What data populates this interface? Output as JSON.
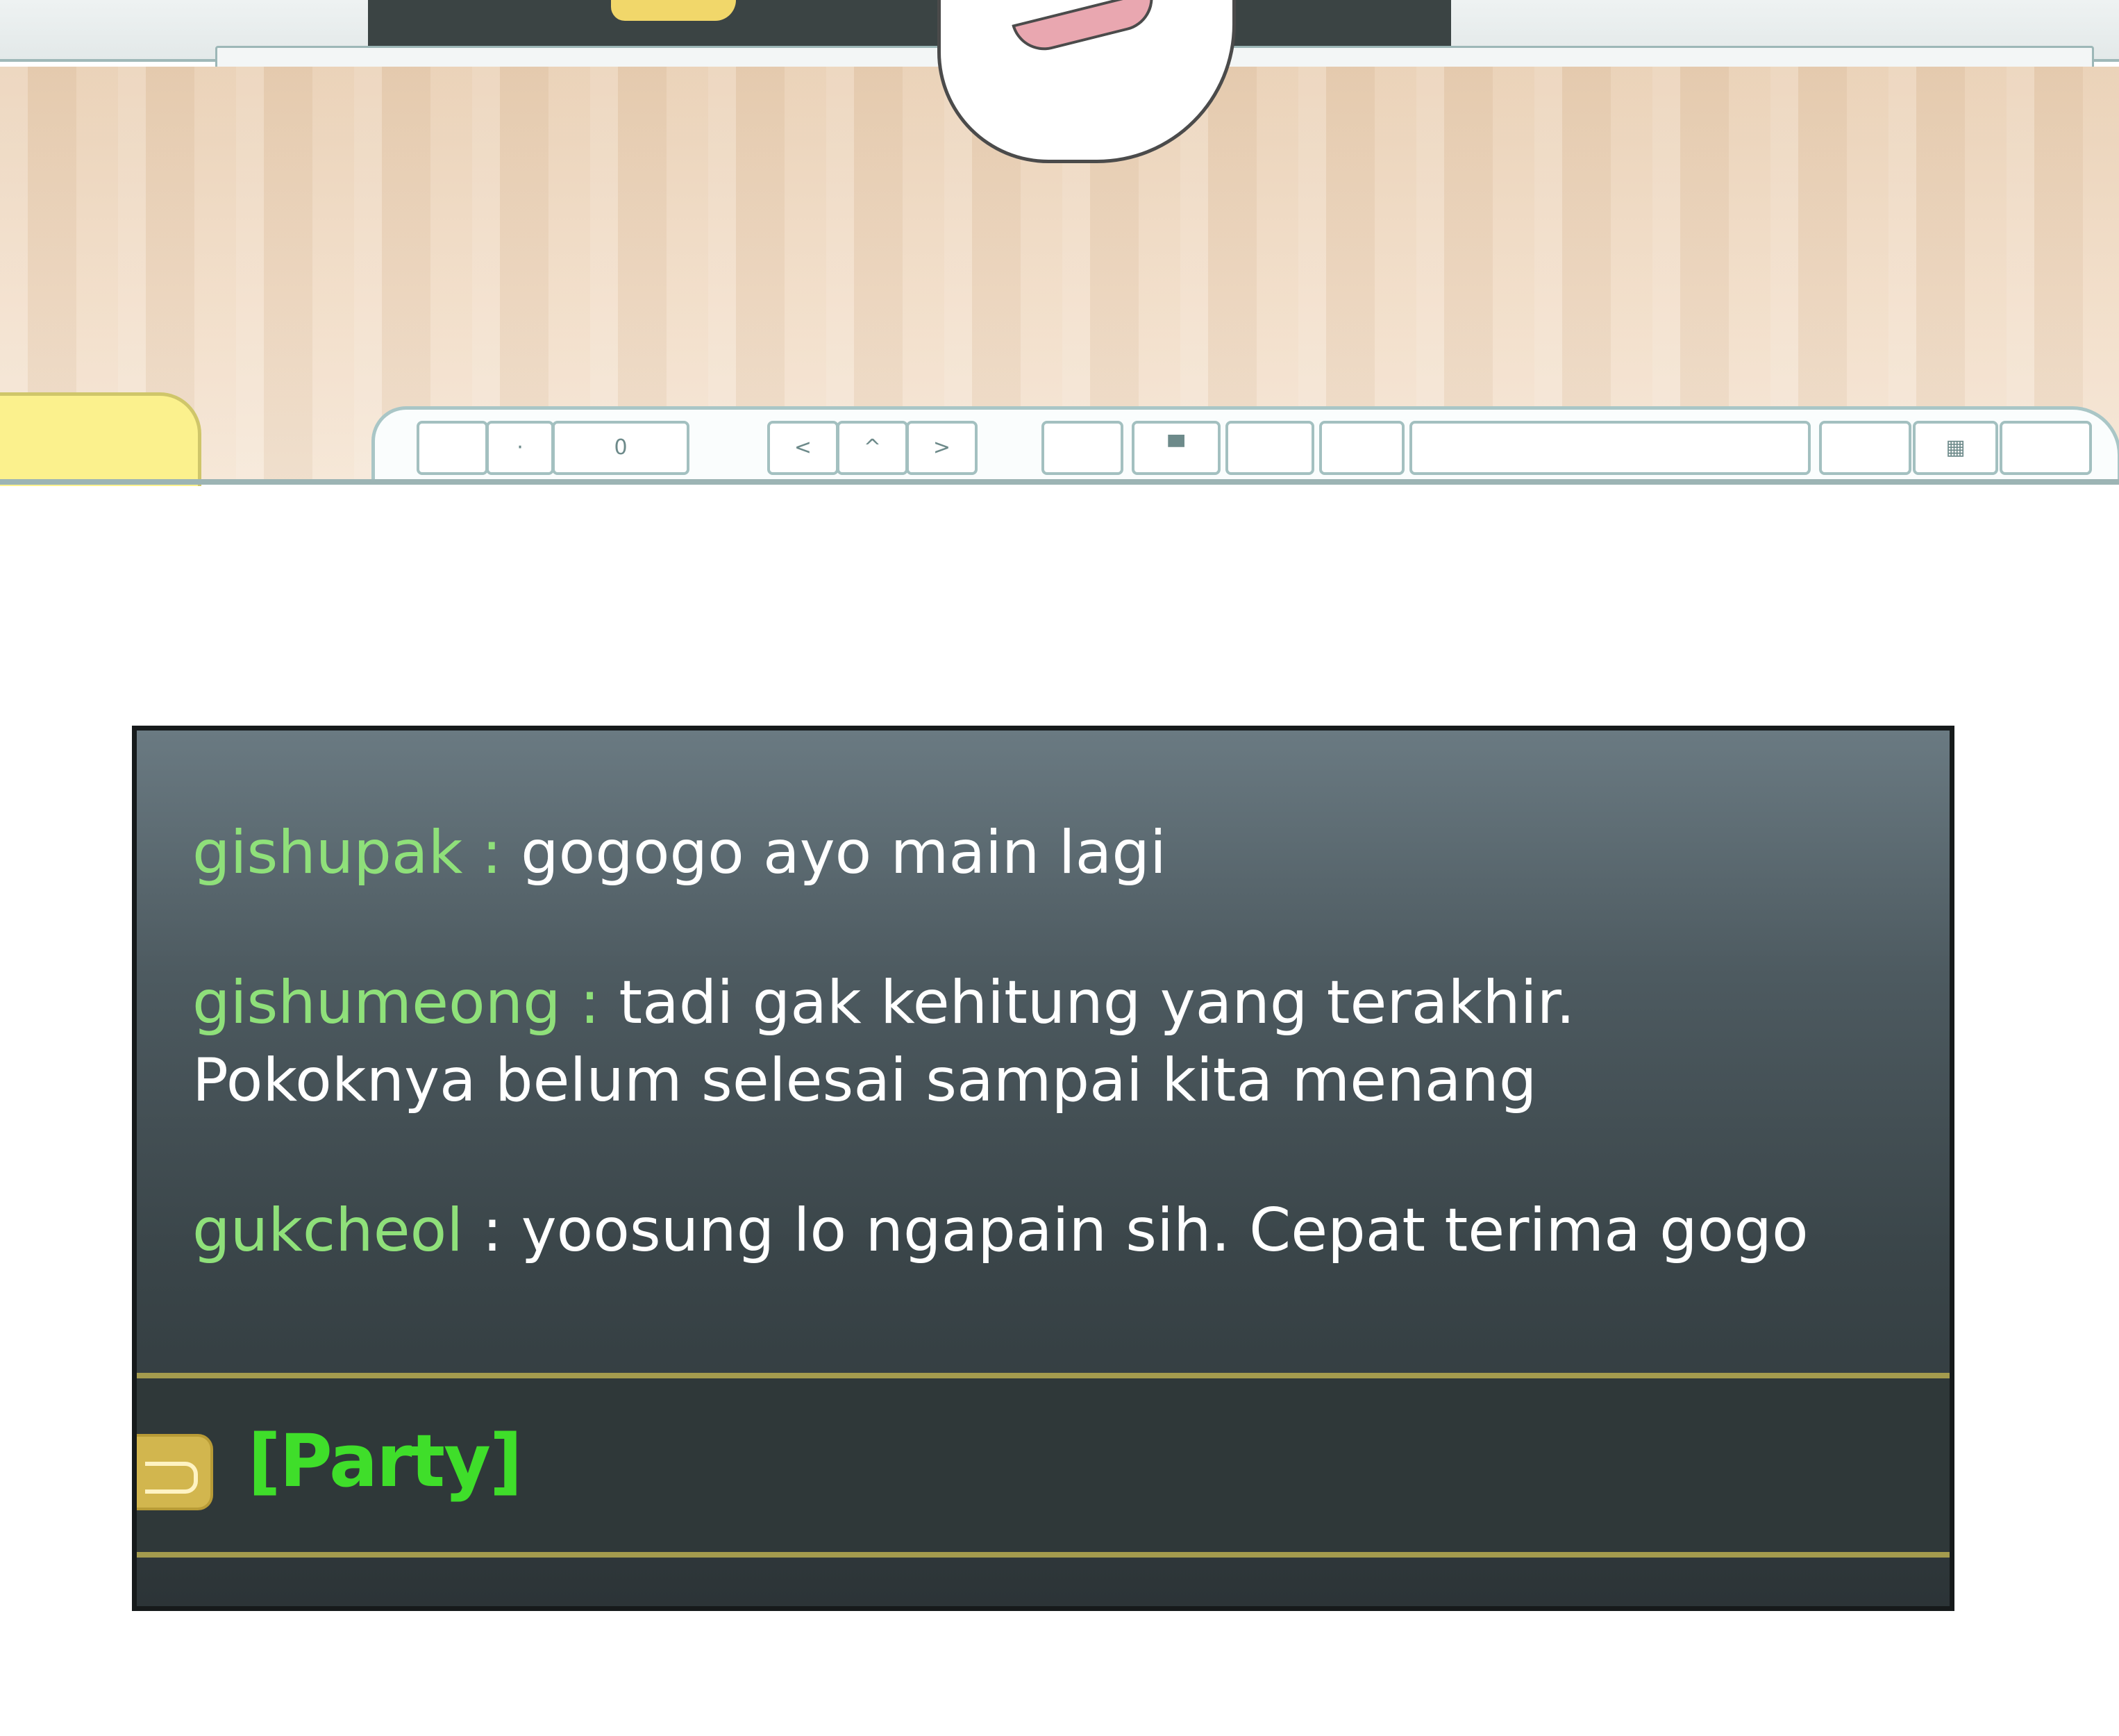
{
  "illustration": {
    "keyboard_keys": [
      "",
      "·",
      "0",
      "<",
      "^",
      ">",
      "",
      "▀",
      "",
      "",
      "",
      "",
      "▦",
      ""
    ]
  },
  "chat": {
    "messages": [
      {
        "user": "gishupak",
        "separator": " : ",
        "text": "gogogo ayo main lagi"
      },
      {
        "user": "gishumeong",
        "separator": " : ",
        "text": "tadi gak kehitung yang terakhir.",
        "text2": "Pokoknya belum selesai sampai kita menang"
      },
      {
        "user": "gukcheol",
        "separator": " : ",
        "text": "yoosung lo ngapain sih. Cepat terima gogo"
      }
    ],
    "channel": "[Party]"
  },
  "colors": {
    "username": "#8fe07a",
    "channel": "#3fde2a",
    "divider": "#a49b4e",
    "tab": "#d2b64e"
  }
}
